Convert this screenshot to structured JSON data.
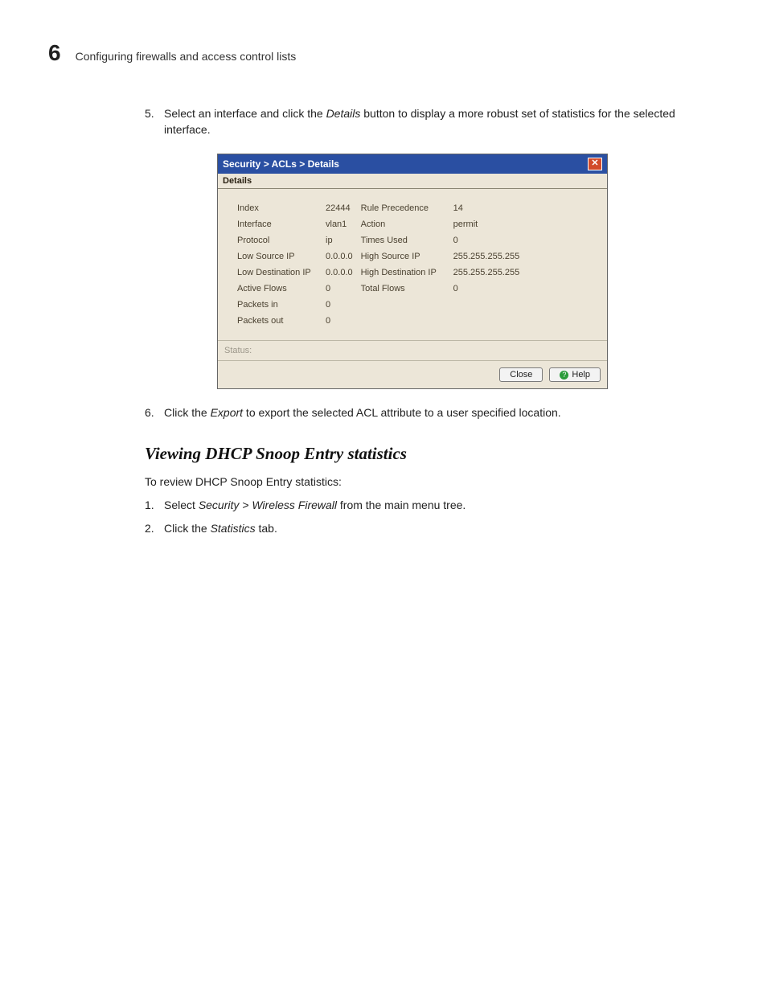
{
  "header": {
    "chapter_number": "6",
    "title": "Configuring firewalls and access control lists"
  },
  "step5": {
    "num": "5.",
    "pre": "Select an interface and click the ",
    "em": "Details",
    "post": " button to display a more robust set of statistics for the selected interface."
  },
  "dialog": {
    "title": "Security > ACLs > Details",
    "tab": "Details",
    "left": {
      "index_l": "Index",
      "index_v": "22444",
      "if_l": "Interface",
      "if_v": "vlan1",
      "proto_l": "Protocol",
      "proto_v": "ip",
      "lsip_l": "Low Source IP",
      "lsip_v": "0.0.0.0",
      "ldip_l": "Low Destination IP",
      "ldip_v": "0.0.0.0",
      "af_l": "Active Flows",
      "af_v": "0",
      "pin_l": "Packets in",
      "pin_v": "0",
      "pout_l": "Packets out",
      "pout_v": "0"
    },
    "right": {
      "rp_l": "Rule Precedence",
      "rp_v": "14",
      "act_l": "Action",
      "act_v": "permit",
      "tu_l": "Times Used",
      "tu_v": "0",
      "hsip_l": "High Source IP",
      "hsip_v": "255.255.255.255",
      "hdip_l": "High Destination IP",
      "hdip_v": "255.255.255.255",
      "tf_l": "Total Flows",
      "tf_v": "0"
    },
    "status_label": "Status:",
    "buttons": {
      "close": "Close",
      "help": "Help"
    }
  },
  "step6": {
    "num": "6.",
    "pre": "Click the ",
    "em": "Export",
    "post": " to export the selected ACL attribute to a user specified location."
  },
  "section": {
    "heading": "Viewing DHCP Snoop Entry statistics",
    "intro": "To review DHCP Snoop Entry statistics:"
  },
  "ol": {
    "n1": "1.",
    "t1a": "Select ",
    "t1em": "Security > Wireless Firewall",
    "t1b": " from the main menu tree.",
    "n2": "2.",
    "t2a": "Click the ",
    "t2em": "Statistics",
    "t2b": " tab."
  }
}
